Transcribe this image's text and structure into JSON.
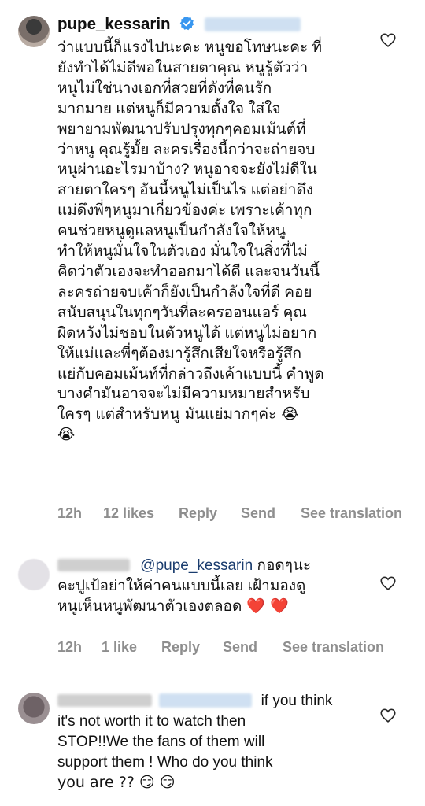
{
  "comments": [
    {
      "username": "pupe_kessarin",
      "verified": true,
      "lines": [
        "ว่าแบบนี้ก็แรงไปนะคะ หนูขอโทษนะคะ ที่",
        "ยังทำได้ไม่ดีพอในสายตาคุณ หนูรู้ตัวว่า",
        "หนูไม่ใช่นางเอกที่สวยที่ดังที่คนรัก",
        "มากมาย แต่หนูก็มีความตั้งใจ ใส่ใจ",
        "พยายามพัฒนาปรับปรุงทุกๆคอมเม้นต์ที่",
        "ว่าหนู คุณรู้มั้ย ละครเรื่องนี้กว่าจะถ่ายจบ",
        "หนูผ่านอะไรมาบ้าง? หนูอาจจะยังไม่ดีใน",
        "สายตาใครๆ  อันนี้หนูไม่เป็นไร แต่อย่าดึง",
        "แม่ดึงพี่ๆหนูมาเกี่ยวข้องค่ะ เพราะเค้าทุก",
        "คนช่วยหนูดูแลหนูเป็นกำลังใจให้หนู",
        "ทำให้หนูมั่นใจในตัวเอง มั่นใจในสิ่งที่ไม่",
        "คิดว่าตัวเองจะทำออกมาได้ดี และจนวันนี้",
        "ละครถ่ายจบเค้าก็ยังเป็นกำลังใจที่ดี คอย",
        "สนับสนุนในทุกๆวันที่ละครออนแอร์ คุณ",
        "ผิดหวังไม่ชอบในตัวหนูได้ แต่หนูไม่อยาก",
        "ให้แม่และพี่ๆต้องมารู้สึกเสียใจหรือรู้สึก",
        "แย่กับคอมเม้นท์ที่กล่าวถึงเค้าแบบนี้ คำพูด",
        "บางคำมันอาจจะไม่มีความหมายสำหรับ",
        "ใครๆ แต่สำหรับหนู มันแย่มากๆค่ะ 😭",
        "😭"
      ],
      "time": "12h",
      "likes": "12 likes",
      "reply": "Reply",
      "send": "Send",
      "translate": "See translation"
    },
    {
      "mention": "@pupe_kessarin",
      "line1_rest": " กอดๆนะ",
      "lines": [
        "คะปูเป้อย่าให้ค่าคนแบบนี้เลย เฝ้ามองดู",
        "หนูเห็นหนูพัฒนาตัวเองตลอด ❤️ ❤️"
      ],
      "time": "12h",
      "likes": "1 like",
      "reply": "Reply",
      "send": "Send",
      "translate": "See translation"
    },
    {
      "line1": "if you think",
      "lines": [
        "it's not worth it to watch then",
        "STOP!!We the fans of them will",
        "support them ! Who do you think",
        "you are ?? 😏 😏"
      ]
    }
  ],
  "icons": {
    "like": "heart-outline-icon",
    "verified": "verified-badge-icon"
  },
  "colors": {
    "meta": "#8e8e8e",
    "mention": "#1a3c6e",
    "verified": "#3897f0"
  }
}
